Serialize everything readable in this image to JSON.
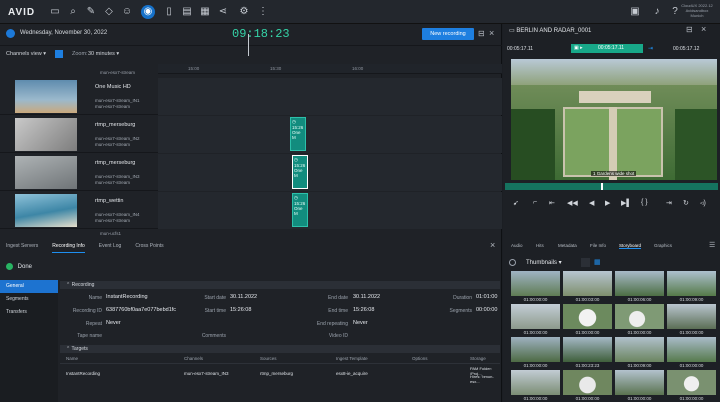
{
  "app": {
    "logo": "AVID"
  },
  "topbar": {
    "icons": [
      "folder-icon",
      "search-icon",
      "edit-icon",
      "browse-icon",
      "user-icon",
      "record-icon",
      "bookmark-icon",
      "project-icon",
      "grid-icon",
      "share-icon",
      "settings-icon",
      "more-icon"
    ],
    "system_text": [
      "CloudUX 2022.12",
      "Avidsandbox",
      "Munich"
    ]
  },
  "recorder": {
    "date": "Wednesday, November 30, 2022",
    "time": "09:18:23",
    "new_recording_label": "New recording",
    "view_label": "Channels view",
    "zoom_label": "Zoom:",
    "zoom_value": "30 minutes",
    "time_ticks": [
      "15:00",
      "15:30",
      "16:00"
    ],
    "group_label": "mun-esx7-stream",
    "group_label_2": "mun-ucfs1",
    "channels": [
      {
        "name": "One Music HD",
        "sub1": "mun-esx7-stream_IN1",
        "sub2": "mun-esx7-stream"
      },
      {
        "name": "rtmp_merseburg",
        "sub1": "mun-esx7-stream_IN2",
        "sub2": "mun-esx7-stream"
      },
      {
        "name": "rtmp_merseburg",
        "sub1": "mun-esx7-stream_IN3",
        "sub2": "mun-esx7-stream"
      },
      {
        "name": "rtmp_wettin",
        "sub1": "mun-esx7-stream_IN4",
        "sub2": "mun-esx7-stream"
      }
    ],
    "block_time": "15:26",
    "block_label": "One M"
  },
  "detail": {
    "tabs": [
      "Ingest Servers",
      "Recording Info",
      "Event Log",
      "Cross Points"
    ],
    "active_tab": "Recording Info",
    "status": "Done",
    "sidebar": [
      "General",
      "Segments",
      "Transfers"
    ],
    "recording_header": "Recording",
    "fields": {
      "name_label": "Name",
      "name": "InstantRecording",
      "start_date_label": "Start date",
      "start_date": "30.11.2022",
      "end_date_label": "End date",
      "end_date": "30.11.2022",
      "duration_label": "Duration",
      "duration": "01:01:00",
      "rec_id_label": "Recording ID",
      "rec_id": "6387760bf0aa7e077bebd1fc",
      "start_time_label": "Start time",
      "start_time": "15:26:08",
      "end_time_label": "End time",
      "end_time": "15:26:08",
      "segments_label": "Segments",
      "segments": "00:00:00",
      "repeat_label": "Repeat",
      "repeat": "Never",
      "end_repeating_label": "End repeating",
      "end_repeating": "Never",
      "tape_label": "Tape name",
      "comments_label": "Comments",
      "video_id_label": "Video ID"
    },
    "targets_header": "Targets",
    "targets_cols": [
      "Name",
      "Channels",
      "Sources",
      "Ingest Template",
      "Options",
      "Storage"
    ],
    "targets_row": [
      "InstantRecording",
      "mun-esx7-stream_IN3",
      "rtmp_merseburg",
      "esx8-ie_acquire",
      "",
      "PAM Folder: /Proj..."
    ],
    "targets_row2": "Hires: 'bmun-esx..."
  },
  "player": {
    "title": "BERLIN AND RADAR_0001",
    "tc_left": "00:05:17.11",
    "tc_mid": "00:05:17.11",
    "tc_right": "00:05:17.12",
    "caption": "1 Gardens wide shot",
    "tabs": [
      "Audio",
      "Hits",
      "Metadata",
      "File Info",
      "Storyboard",
      "Graphics"
    ],
    "active_tab": "Storyboard",
    "thumb_label": "Thumbnails",
    "storyboard": [
      [
        "01:00:00:00",
        "01:00:03:00",
        "01:00:06:00",
        "01:00:09:00"
      ],
      [
        "01:00:00:00",
        "01:00:00:00",
        "01:00:00:00",
        "01:00:00:00"
      ],
      [
        "01:00:00:00",
        "01:00:23:23",
        "01:00:09:00",
        "01:00:00:00"
      ],
      [
        "01:00:00:00",
        "01:00:00:00",
        "01:00:00:00",
        "01:00:00:00"
      ]
    ]
  }
}
